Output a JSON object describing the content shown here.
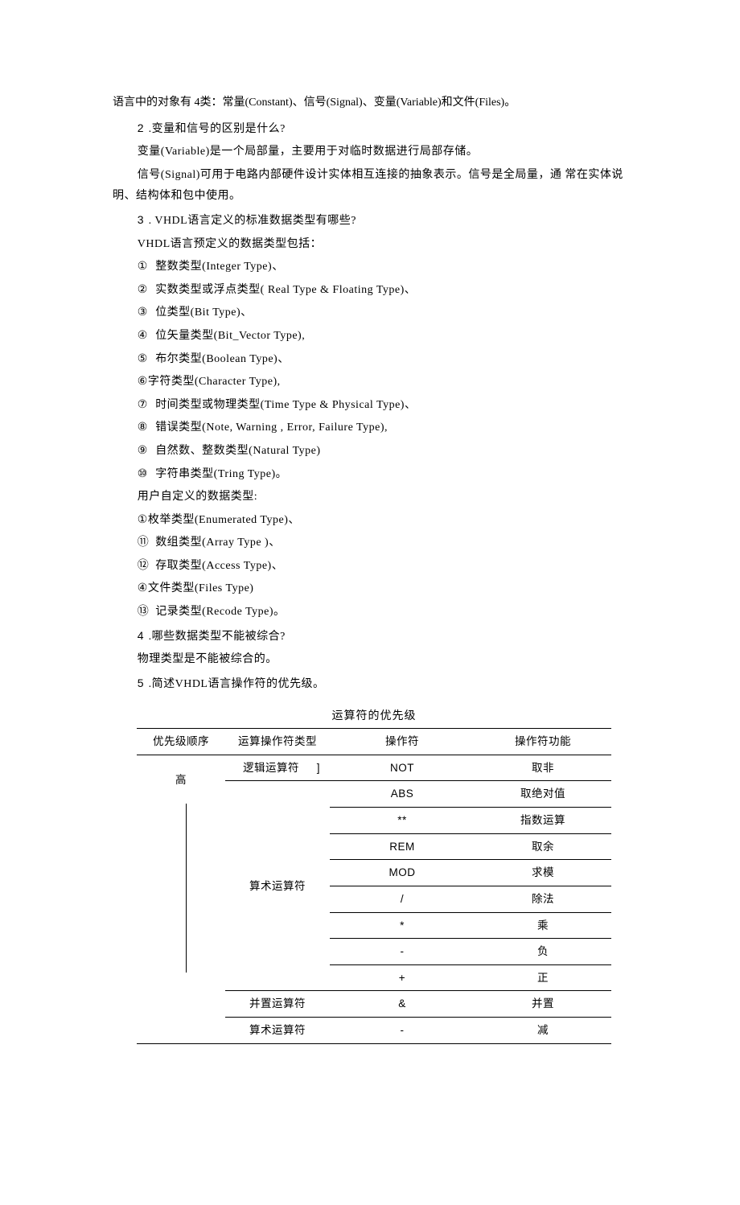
{
  "intro": "语言中的对象有 4类：常量(Constant)、信号(Signal)、变量(Variable)和文件(Files)。",
  "q2": {
    "num": "2",
    "q": " .变量和信号的区别是什么?",
    "a1": "变量(Variable)是一个局部量，主要用于对临时数据进行局部存储。",
    "a2": "信号(Signal)可用于电路内部硬件设计实体相互连接的抽象表示。信号是全局量，通 常在实体说明、结构体和包中使用。"
  },
  "q3": {
    "num": "3",
    "q": " . VHDL语言定义的标准数据类型有哪些?",
    "intro": "VHDL语言预定义的数据类型包括：",
    "items": [
      {
        "n": "①",
        "t": "整数类型(Integer Type)、"
      },
      {
        "n": "②",
        "t": "实数类型或浮点类型(  Real Type & Floating Type)、"
      },
      {
        "n": "③",
        "t": "位类型(Bit Type)、"
      },
      {
        "n": "④",
        "t": "位矢量类型(Bit_Vector Type),"
      },
      {
        "n": "⑤",
        "t": "布尔类型(Boolean Type)、"
      },
      {
        "n": "⑥",
        "t": "字符类型(Character Type),"
      },
      {
        "n": "⑦",
        "t": "时间类型或物理类型(Time Type & Physical Type)、"
      },
      {
        "n": "⑧",
        "t": "错误类型(Note, Warning , Error, Failure Type),"
      },
      {
        "n": "⑨",
        "t": "自然数、整数类型(Natural Type)"
      },
      {
        "n": "⑩",
        "t": "字符串类型(Tring Type)。"
      }
    ],
    "userdef_intro": "用户自定义的数据类型:",
    "userdefs": [
      {
        "n": "①",
        "t": "枚举类型(Enumerated Type)、"
      },
      {
        "n": "⑪",
        "t": "数组类型(Array Type )、"
      },
      {
        "n": "⑫",
        "t": "存取类型(Access Type)、"
      },
      {
        "n": "④",
        "t": "文件类型(Files Type)"
      },
      {
        "n": "⑬",
        "t": "记录类型(Recode Type)。"
      }
    ]
  },
  "q4": {
    "num": "4",
    "q": " .哪些数据类型不能被综合?",
    "a": "物理类型是不能被综合的。"
  },
  "q5": {
    "num": "5",
    "q": " .简述VHDL语言操作符的优先级。"
  },
  "table": {
    "title": "运算符的优先级",
    "headers": [
      "优先级顺序",
      "运算操作符类型",
      "操作符",
      "操作符功能"
    ],
    "priority_label": "高",
    "rows": [
      {
        "kind": "逻辑运算符",
        "op": "NOT",
        "fn": "取非"
      },
      {
        "kind": "算术运算符",
        "op": "ABS",
        "fn": "取绝对值"
      },
      {
        "kind": "",
        "op": "**",
        "fn": "指数运算"
      },
      {
        "kind": "",
        "op": "REM",
        "fn": "取余"
      },
      {
        "kind": "",
        "op": "MOD",
        "fn": "求模"
      },
      {
        "kind": "",
        "op": "/",
        "fn": "除法"
      },
      {
        "kind": "",
        "op": "*",
        "fn": "乘"
      },
      {
        "kind": "",
        "op": "-",
        "fn": "负"
      },
      {
        "kind": "",
        "op": "+",
        "fn": "正"
      },
      {
        "kind": "并置运算符",
        "op": "&",
        "fn": "并置"
      },
      {
        "kind": "算术运算符",
        "op": "-",
        "fn": "减"
      }
    ]
  }
}
